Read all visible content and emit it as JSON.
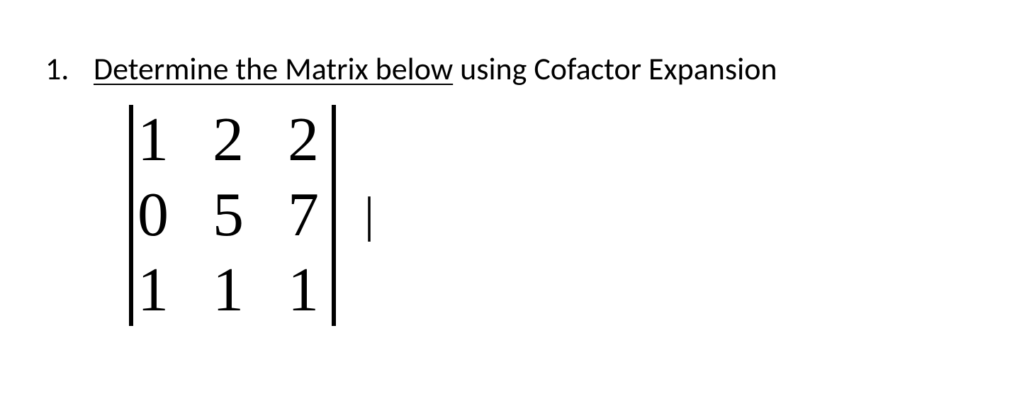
{
  "problem": {
    "number": "1.",
    "text_underlined": "Determine the Matrix below",
    "text_rest": " using Cofactor Expansion"
  },
  "matrix": {
    "rows": [
      [
        "1",
        "2",
        "2"
      ],
      [
        "0",
        "5",
        "7"
      ],
      [
        "1",
        "1",
        "1"
      ]
    ]
  },
  "cursor": "|"
}
